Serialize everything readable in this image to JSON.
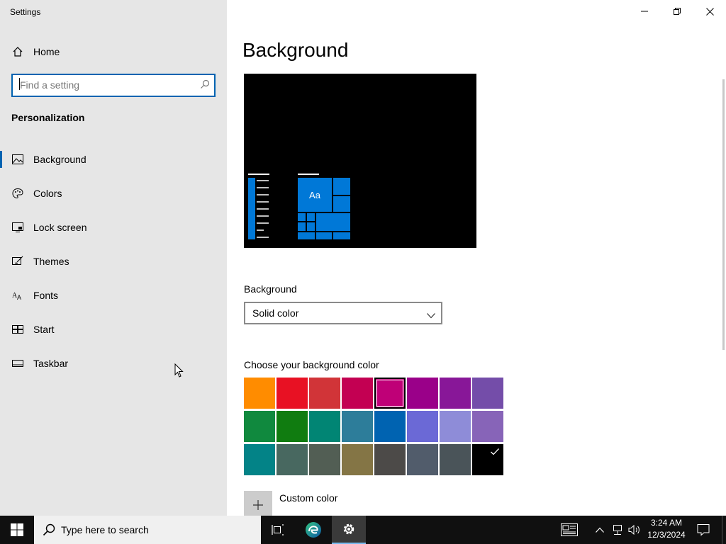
{
  "window": {
    "title": "Settings"
  },
  "sidebar": {
    "home_label": "Home",
    "search_placeholder": "Find a setting",
    "section_title": "Personalization",
    "items": [
      {
        "label": "Background",
        "icon": "picture-icon",
        "selected": true
      },
      {
        "label": "Colors",
        "icon": "palette-icon"
      },
      {
        "label": "Lock screen",
        "icon": "lock-screen-icon"
      },
      {
        "label": "Themes",
        "icon": "brush-icon"
      },
      {
        "label": "Fonts",
        "icon": "fonts-icon"
      },
      {
        "label": "Start",
        "icon": "start-tiles-icon"
      },
      {
        "label": "Taskbar",
        "icon": "taskbar-icon"
      }
    ]
  },
  "main": {
    "title": "Background",
    "preview_sample_text": "Aa",
    "background_label": "Background",
    "background_value": "Solid color",
    "choose_color_label": "Choose your background color",
    "colors": [
      [
        "#ff8c00",
        "#e81123",
        "#d13438",
        "#c30052",
        "#bf0077",
        "#9a0089",
        "#881798",
        "#744da9"
      ],
      [
        "#10893e",
        "#107c10",
        "#018574",
        "#2d7d9a",
        "#0063b1",
        "#6b69d6",
        "#8e8cd8",
        "#8764b8"
      ],
      [
        "#038387",
        "#486860",
        "#525e54",
        "#847545",
        "#4c4a48",
        "#515c6b",
        "#4a5459",
        "#000000"
      ]
    ],
    "hovered_color": "#bf0077",
    "selected_color": "#000000",
    "custom_color_label": "Custom color"
  },
  "accent": "#0078d7",
  "taskbar": {
    "search_placeholder": "Type here to search",
    "time": "3:24 AM",
    "date": "12/3/2024"
  }
}
